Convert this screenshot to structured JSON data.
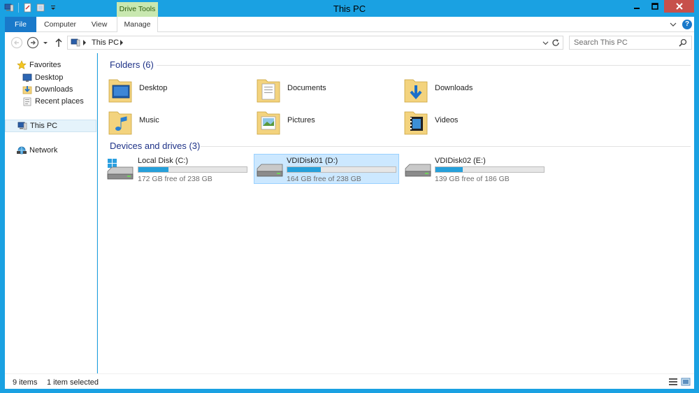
{
  "window": {
    "title": "This PC",
    "context_tab": "Drive Tools"
  },
  "ribbon": {
    "tabs": [
      "File",
      "Computer",
      "View",
      "Manage"
    ],
    "help_glyph": "?"
  },
  "address_bar": {
    "path": "This PC",
    "search_placeholder": "Search This PC"
  },
  "sidebar": {
    "favorites": "Favorites",
    "favorite_items": [
      "Desktop",
      "Downloads",
      "Recent places"
    ],
    "this_pc": "This PC",
    "network": "Network"
  },
  "folders": {
    "header": "Folders (6)",
    "items": [
      "Desktop",
      "Documents",
      "Downloads",
      "Music",
      "Pictures",
      "Videos"
    ]
  },
  "drives": {
    "header": "Devices and drives (3)",
    "items": [
      {
        "name": "Local Disk (C:)",
        "free": "172 GB free of 238 GB",
        "used_fraction": 0.277
      },
      {
        "name": "VDIDisk01 (D:)",
        "free": "164 GB free of 238 GB",
        "used_fraction": 0.311
      },
      {
        "name": "VDIDisk02 (E:)",
        "free": "139 GB free of 186 GB",
        "used_fraction": 0.253
      }
    ]
  },
  "status": {
    "item_count": "9 items",
    "selection": "1 item selected"
  },
  "colors": {
    "window_frame": "#1aa1e2",
    "file_tab": "#1979ca",
    "context_tab": "#c9e8b0",
    "close_button": "#c7504b",
    "drive_bar": "#26a0da",
    "selection": "#cce8ff",
    "group_header": "#1e3287"
  }
}
